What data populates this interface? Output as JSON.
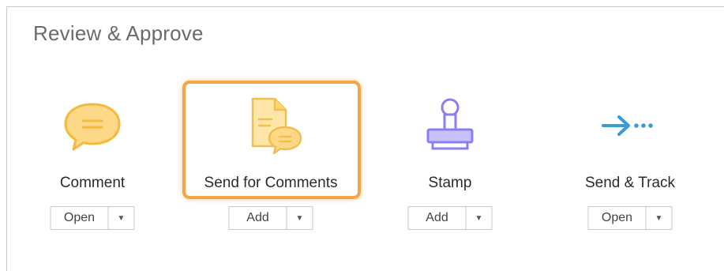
{
  "section": {
    "title": "Review & Approve"
  },
  "tools": [
    {
      "label": "Comment",
      "button": "Open",
      "icon": "comment-icon"
    },
    {
      "label": "Send for Comments",
      "button": "Add",
      "icon": "send-for-comments-icon"
    },
    {
      "label": "Stamp",
      "button": "Add",
      "icon": "stamp-icon"
    },
    {
      "label": "Send & Track",
      "button": "Open",
      "icon": "send-track-icon"
    }
  ],
  "colors": {
    "comment_yellow": "#fbd77a",
    "comment_stroke": "#f5b93c",
    "stamp_purple": "#8a7ff0",
    "send_track_blue": "#3a9bd9",
    "highlight_orange": "#f4a54a"
  }
}
